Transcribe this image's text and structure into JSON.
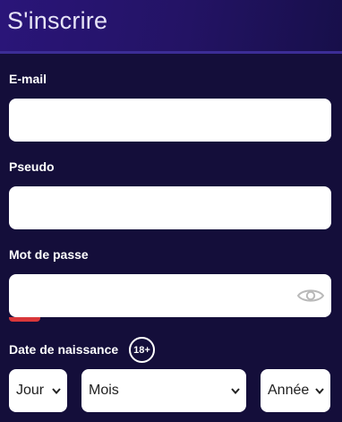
{
  "header": {
    "title": "S'inscrire"
  },
  "form": {
    "email": {
      "label": "E-mail",
      "value": ""
    },
    "pseudo": {
      "label": "Pseudo",
      "value": ""
    },
    "password": {
      "label": "Mot de passe",
      "value": "",
      "strength_color": "#d9373a"
    },
    "birthdate": {
      "label": "Date de naissance",
      "age_badge": "18+",
      "day_selected": "Jour",
      "month_selected": "Mois",
      "year_selected": "Année"
    }
  },
  "colors": {
    "background": "#140e3a",
    "header": "#2a1579",
    "input": "#ffffff"
  },
  "icons": {
    "password_toggle": "eye-icon",
    "select_arrow": "chevron-down-icon"
  }
}
